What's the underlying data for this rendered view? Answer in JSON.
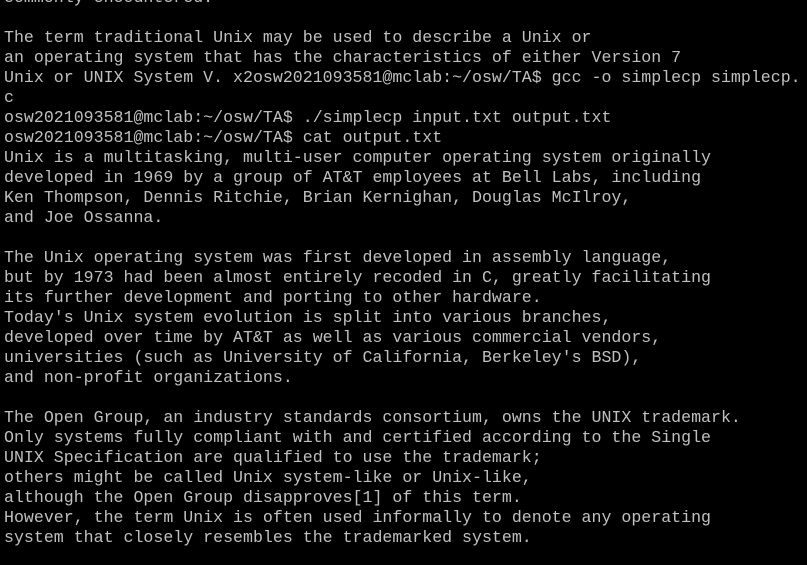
{
  "terminal": {
    "foreground": "#c0c0c0",
    "background": "#000000",
    "lines": [
      "commonly encountered.",
      "",
      "The term traditional Unix may be used to describe a Unix or",
      "an operating system that has the characteristics of either Version 7",
      "Unix or UNIX System V. x2osw2021093581@mclab:~/osw/TA$ gcc -o simplecp simplecp.",
      "c",
      "osw2021093581@mclab:~/osw/TA$ ./simplecp input.txt output.txt",
      "osw2021093581@mclab:~/osw/TA$ cat output.txt",
      "Unix is a multitasking, multi-user computer operating system originally",
      "developed in 1969 by a group of AT&T employees at Bell Labs, including",
      "Ken Thompson, Dennis Ritchie, Brian Kernighan, Douglas McIlroy,",
      "and Joe Ossanna.",
      "",
      "The Unix operating system was first developed in assembly language,",
      "but by 1973 had been almost entirely recoded in C, greatly facilitating",
      "its further development and porting to other hardware.",
      "Today's Unix system evolution is split into various branches,",
      "developed over time by AT&T as well as various commercial vendors,",
      "universities (such as University of California, Berkeley's BSD),",
      "and non-profit organizations.",
      "",
      "The Open Group, an industry standards consortium, owns the UNIX trademark.",
      "Only systems fully compliant with and certified according to the Single",
      "UNIX Specification are qualified to use the trademark;",
      "others might be called Unix system-like or Unix-like,",
      "although the Open Group disapproves[1] of this term.",
      "However, the term Unix is often used informally to denote any operating",
      "system that closely resembles the trademarked system.",
      ""
    ]
  }
}
